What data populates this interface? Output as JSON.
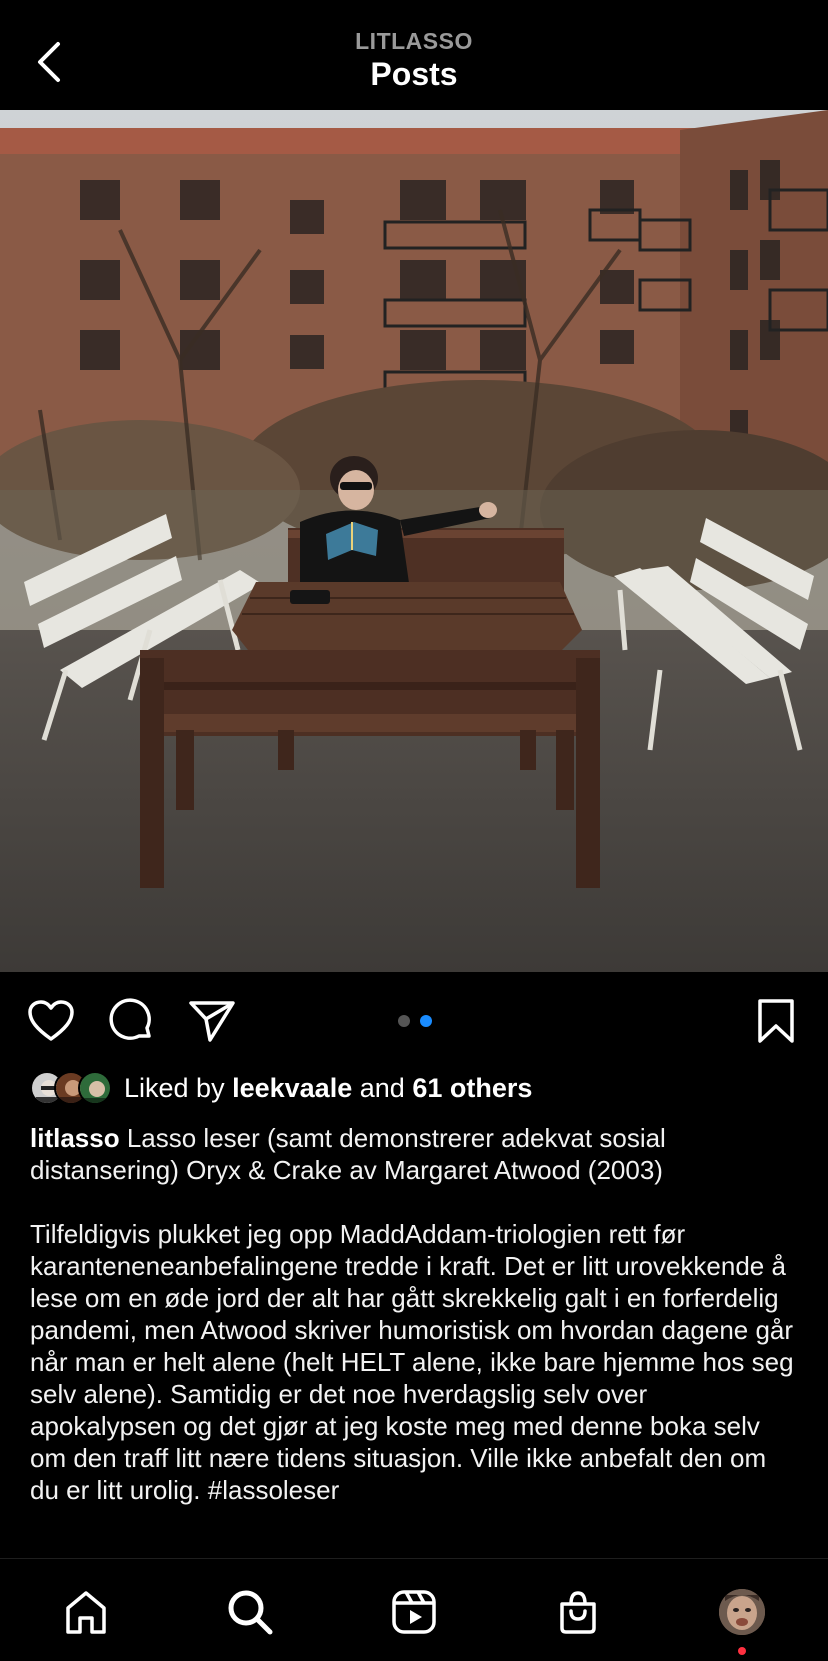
{
  "header": {
    "username": "LITLASSO",
    "title": "Posts"
  },
  "post": {
    "image_alt": "Photo of a woman reading a book at a wooden picnic table between two white benches, apartment building behind",
    "carousel": {
      "count": 2,
      "active_index": 1
    },
    "likes": {
      "prefix": "Liked by",
      "user": "leekvaale",
      "joiner": "and",
      "others": "61 others"
    },
    "caption": {
      "username": "litlasso",
      "text": "Lasso leser (samt demonstrerer adekvat sosial distansering) Oryx & Crake av Margaret Atwood (2003)",
      "body": "Tilfeldigvis plukket jeg opp MaddAddam-triologien rett før karanteneneanbefalingene tredde i kraft. Det er litt urovekkende å lese om en øde jord der alt har gått skrekkelig galt i en forferdelig pandemi, men Atwood skriver humoristisk om hvordan dagene går når man er helt alene (helt HELT alene, ikke bare hjemme hos seg selv alene). Samtidig er det noe hverdagslig selv over apokalypsen og det gjør at jeg koste meg med denne boka selv om den traff litt nære tidens situasjon. Ville ikke anbefalt den om du er litt urolig. #lassoleser"
    }
  },
  "colors": {
    "background": "#000000",
    "accent": "#1a8cff",
    "notification": "#ff3040"
  },
  "icons": {
    "back": "chevron-left-icon",
    "like": "heart-icon",
    "comment": "comment-icon",
    "share": "send-icon",
    "save": "bookmark-icon",
    "nav": [
      "home-icon",
      "search-icon",
      "reels-icon",
      "shop-icon",
      "profile-avatar"
    ]
  }
}
